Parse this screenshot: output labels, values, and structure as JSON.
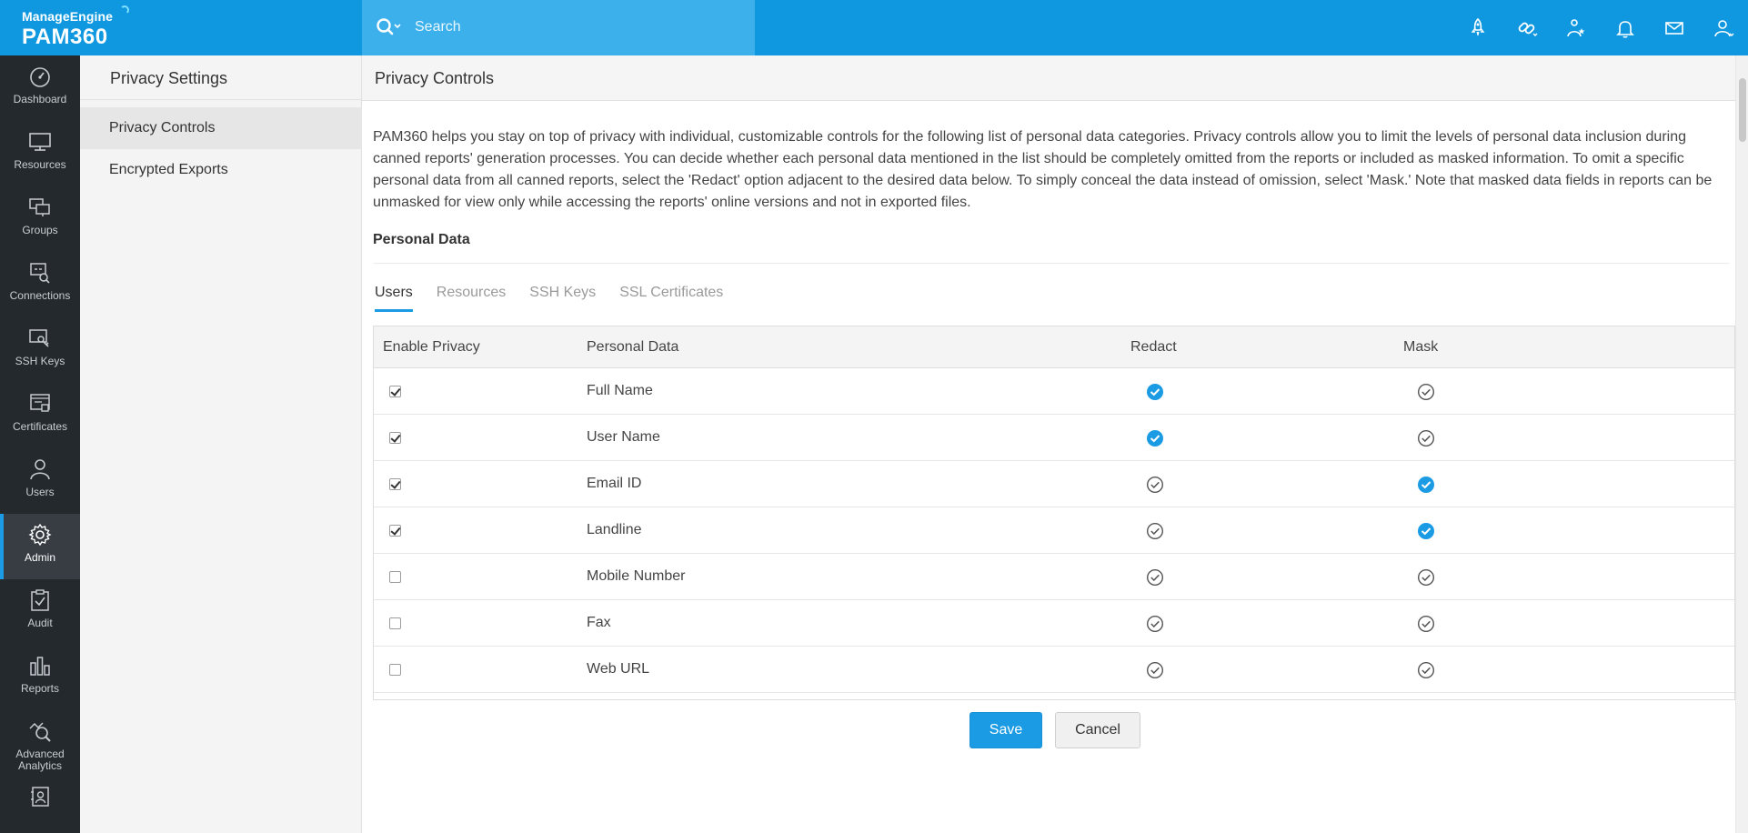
{
  "brand": {
    "vendor": "ManageEngine",
    "product": "PAM360"
  },
  "search": {
    "placeholder": "Search"
  },
  "top_icons": [
    "rocket-icon",
    "link-icon",
    "star-person-icon",
    "bell-icon",
    "mail-icon",
    "user-icon"
  ],
  "nav": [
    {
      "label": "Dashboard",
      "icon": "dashboard-icon"
    },
    {
      "label": "Resources",
      "icon": "monitor-icon"
    },
    {
      "label": "Groups",
      "icon": "groups-icon"
    },
    {
      "label": "Connections",
      "icon": "connections-icon"
    },
    {
      "label": "SSH Keys",
      "icon": "ssh-key-icon"
    },
    {
      "label": "Certificates",
      "icon": "certificate-icon"
    },
    {
      "label": "Users",
      "icon": "user-icon"
    },
    {
      "label": "Admin",
      "icon": "gear-icon",
      "active": true
    },
    {
      "label": "Audit",
      "icon": "clipboard-check-icon"
    },
    {
      "label": "Reports",
      "icon": "bar-chart-icon"
    },
    {
      "label": "Advanced Analytics",
      "icon": "analytics-icon"
    }
  ],
  "settings": {
    "title": "Privacy Settings",
    "items": [
      {
        "label": "Privacy Controls",
        "active": true
      },
      {
        "label": "Encrypted Exports",
        "active": false
      }
    ]
  },
  "main": {
    "title": "Privacy Controls",
    "description": "PAM360 helps you stay on top of privacy with individual, customizable controls for the following list of personal data categories. Privacy controls allow you to limit the levels of personal data inclusion during canned reports' generation processes. You can decide whether each personal data mentioned in the list should be completely omitted from the reports or included as masked information. To omit a specific personal data from all canned reports, select the 'Redact' option adjacent to the desired data below. To simply conceal the data instead of omission, select 'Mask.' Note that masked data fields in reports can be unmasked for view only while accessing the reports' online versions and not in exported files.",
    "section_title": "Personal Data",
    "tabs": [
      {
        "label": "Users",
        "active": true
      },
      {
        "label": "Resources",
        "active": false
      },
      {
        "label": "SSH Keys",
        "active": false
      },
      {
        "label": "SSL Certificates",
        "active": false
      }
    ],
    "table": {
      "columns": [
        "Enable Privacy",
        "Personal Data",
        "Redact",
        "Mask"
      ],
      "rows": [
        {
          "enabled": true,
          "data": "Full Name",
          "option": "redact"
        },
        {
          "enabled": true,
          "data": "User Name",
          "option": "redact"
        },
        {
          "enabled": true,
          "data": "Email ID",
          "option": "mask"
        },
        {
          "enabled": true,
          "data": "Landline",
          "option": "mask"
        },
        {
          "enabled": false,
          "data": "Mobile Number",
          "option": "none"
        },
        {
          "enabled": false,
          "data": "Fax",
          "option": "none"
        },
        {
          "enabled": false,
          "data": "Web URL",
          "option": "none"
        }
      ]
    },
    "buttons": {
      "save": "Save",
      "cancel": "Cancel"
    }
  },
  "colors": {
    "header": "#0f98e0",
    "search_bg": "#3bb0ea",
    "nav_bg": "#24292e",
    "accent": "#1a9be3"
  }
}
